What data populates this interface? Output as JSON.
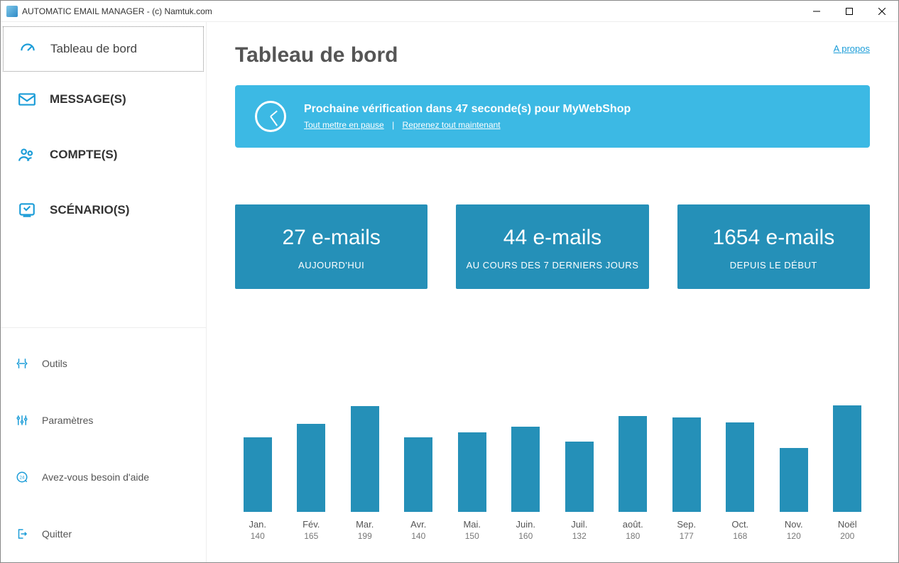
{
  "window": {
    "title": "AUTOMATIC EMAIL MANAGER - (c) Namtuk.com"
  },
  "sidebar": {
    "primary": [
      {
        "label": "Tableau de bord",
        "icon": "gauge-icon",
        "active": true
      },
      {
        "label": "MESSAGE(S)",
        "icon": "mail-icon",
        "active": false
      },
      {
        "label": "COMPTE(S)",
        "icon": "users-icon",
        "active": false
      },
      {
        "label": "SCÉNARIO(S)",
        "icon": "scenario-icon",
        "active": false
      }
    ],
    "secondary": [
      {
        "label": "Outils",
        "icon": "tools-icon"
      },
      {
        "label": "Paramètres",
        "icon": "sliders-icon"
      },
      {
        "label": "Avez-vous besoin d'aide",
        "icon": "support-icon"
      },
      {
        "label": "Quitter",
        "icon": "exit-icon"
      }
    ]
  },
  "header": {
    "title": "Tableau de bord",
    "about": "A propos"
  },
  "banner": {
    "message": "Prochaine vérification dans 47 seconde(s) pour MyWebShop",
    "pause_all": "Tout mettre en pause",
    "resume_all": "Reprenez tout maintenant",
    "separator": "|"
  },
  "stats": [
    {
      "value": "27 e-mails",
      "label": "AUJOURD'HUI"
    },
    {
      "value": "44 e-mails",
      "label": "AU COURS DES 7 DERNIERS JOURS"
    },
    {
      "value": "1654 e-mails",
      "label": "DEPUIS LE DÉBUT"
    }
  ],
  "chart_data": {
    "type": "bar",
    "title": "",
    "xlabel": "",
    "ylabel": "",
    "categories": [
      "Jan.",
      "Fév.",
      "Mar.",
      "Avr.",
      "Mai.",
      "Juin.",
      "Juil.",
      "août.",
      "Sep.",
      "Oct.",
      "Nov.",
      "Noël"
    ],
    "values": [
      140,
      165,
      199,
      140,
      150,
      160,
      132,
      180,
      177,
      168,
      120,
      200
    ],
    "ylim": [
      0,
      200
    ]
  }
}
